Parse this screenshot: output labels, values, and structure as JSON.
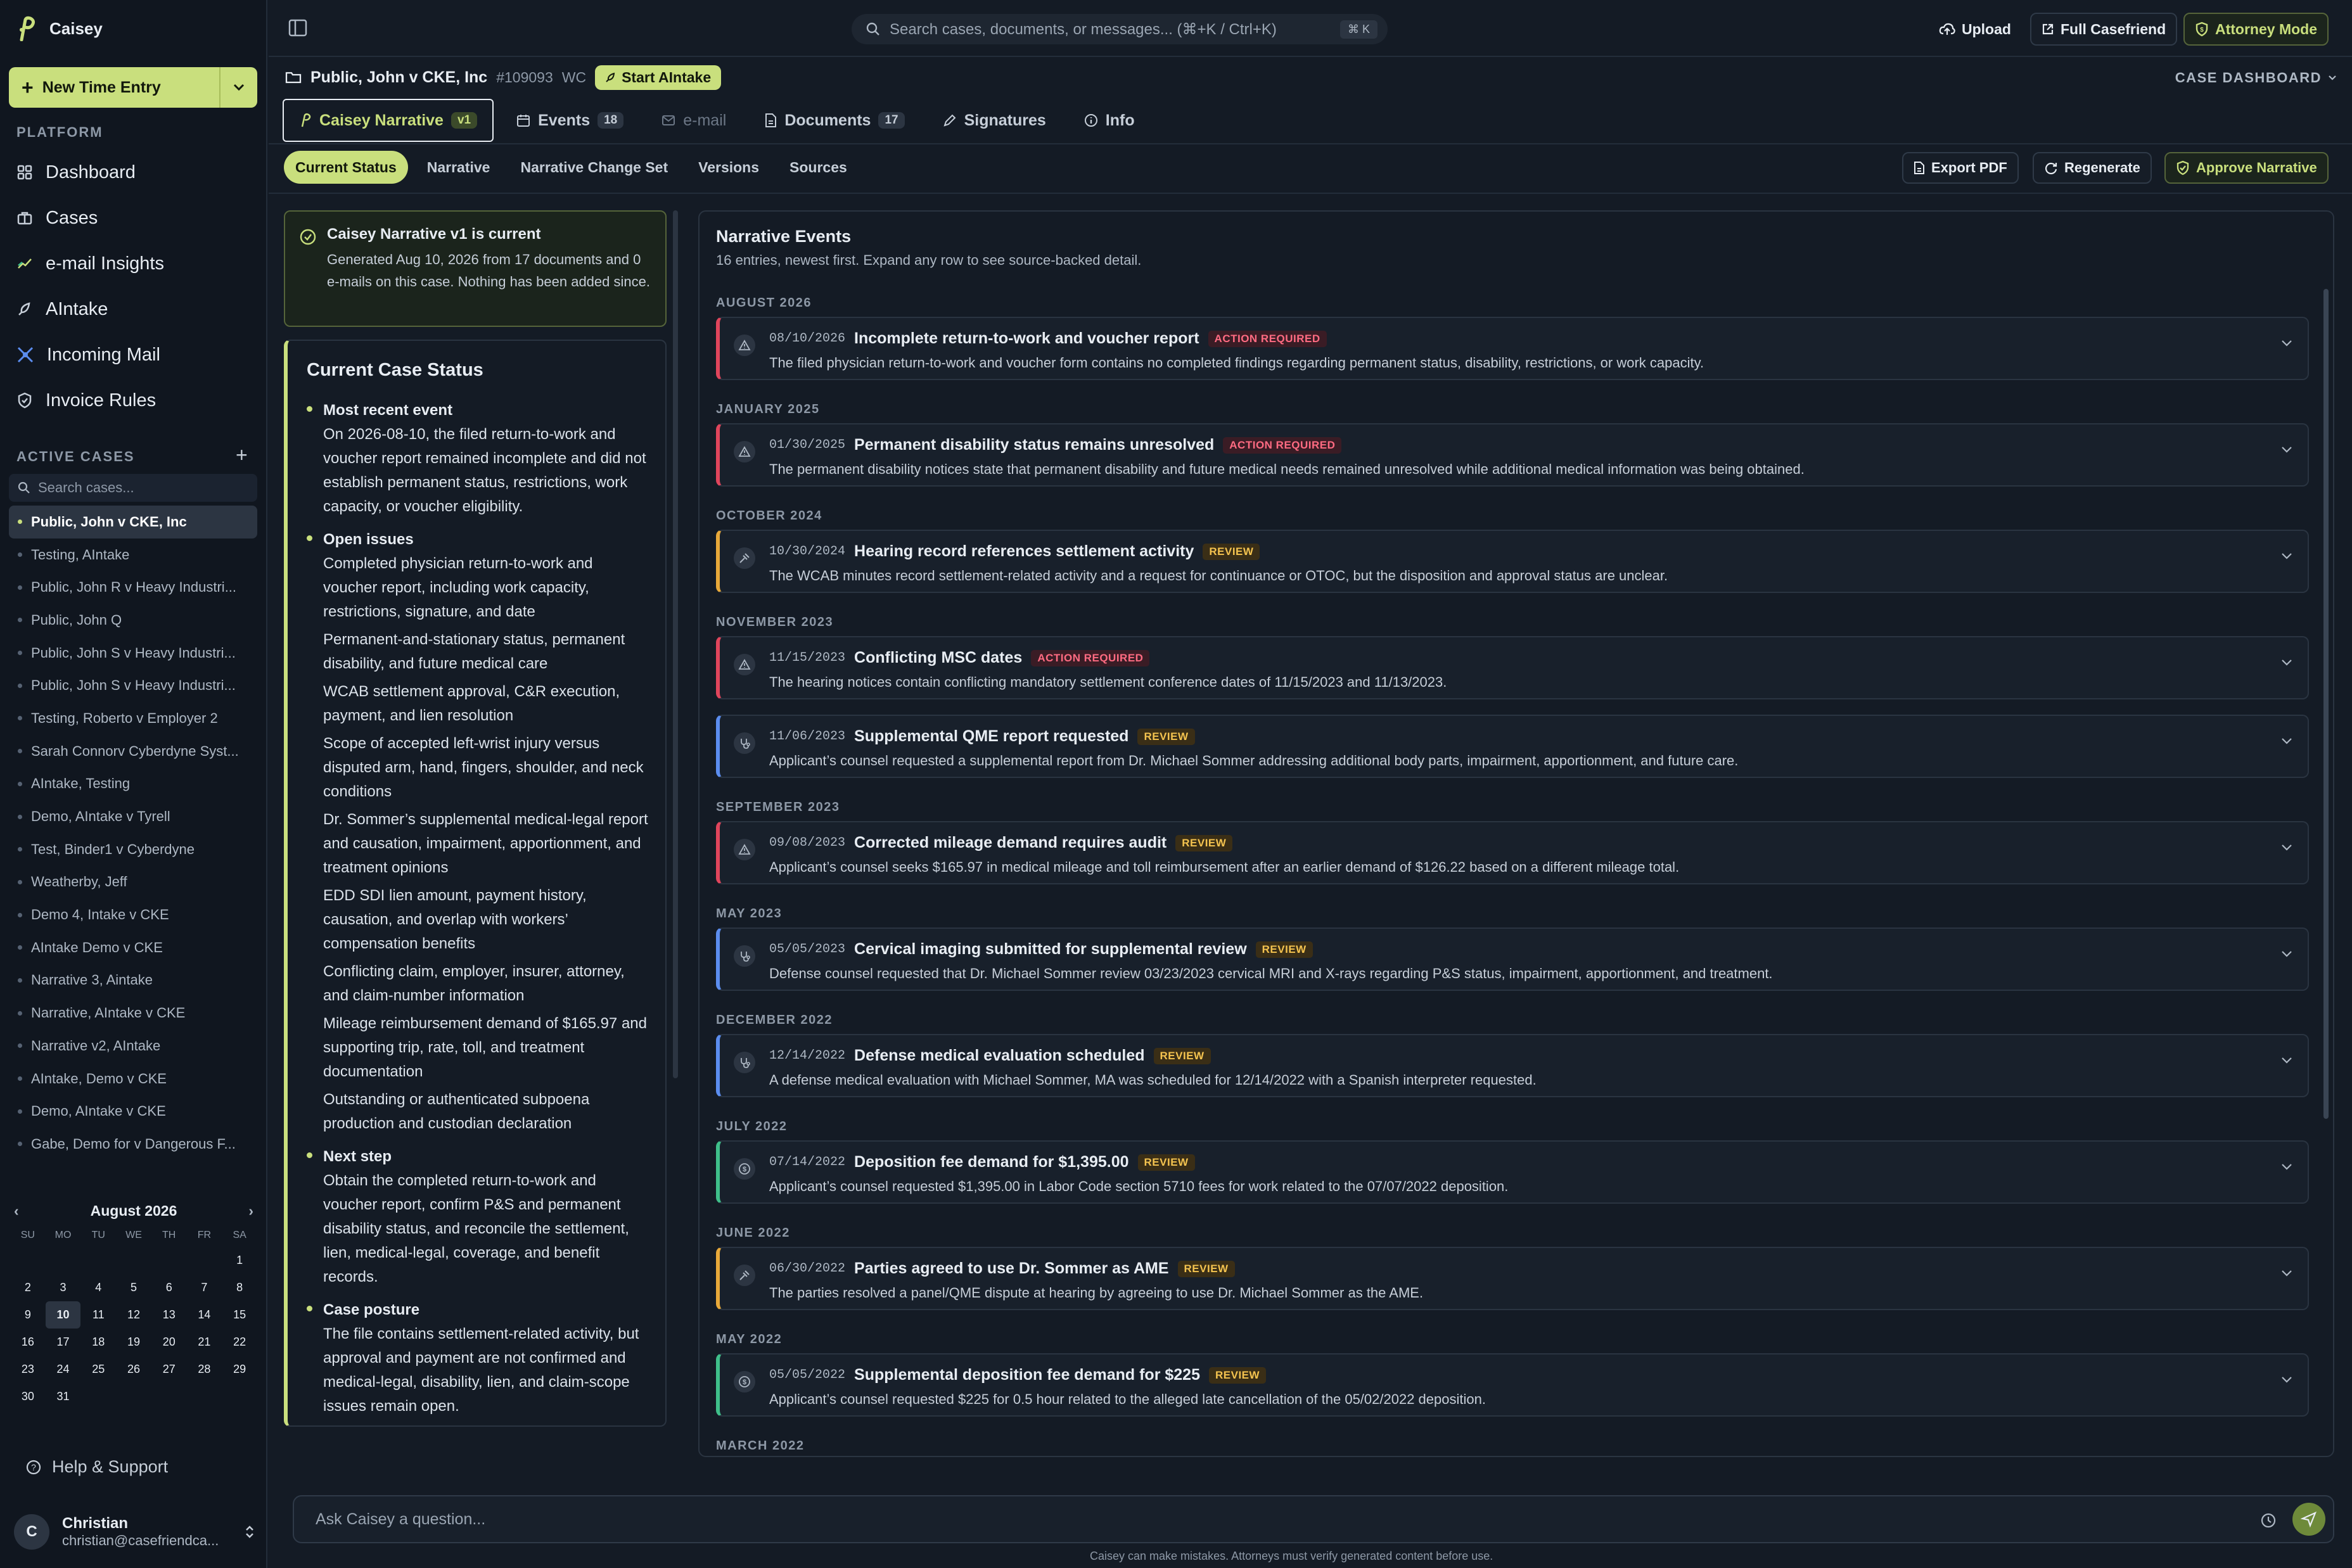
{
  "app": {
    "name": "Caisey"
  },
  "sidebar": {
    "new_time_entry": "New Time Entry",
    "platform_label": "PLATFORM",
    "nav": [
      {
        "label": "Dashboard"
      },
      {
        "label": "Cases"
      },
      {
        "label": "e-mail Insights"
      },
      {
        "label": "AIntake"
      },
      {
        "label": "Incoming Mail"
      },
      {
        "label": "Invoice Rules"
      }
    ],
    "active_cases_label": "ACTIVE CASES",
    "search_placeholder": "Search cases...",
    "cases": [
      "Public, John v CKE, Inc",
      "Testing, AIntake",
      "Public, John R v Heavy Industri...",
      "Public, John Q",
      "Public, John S v Heavy Industri...",
      "Public, John S v Heavy Industri...",
      "Testing, Roberto v Employer 2",
      "Sarah Connorv Cyberdyne Syst...",
      "AIntake, Testing",
      "Demo, AIntake v Tyrell",
      "Test, Binder1 v Cyberdyne",
      "Weatherby, Jeff",
      "Demo 4, Intake v CKE",
      "AIntake Demo v CKE",
      "Narrative 3, Aintake",
      "Narrative, AIntake v CKE",
      "Narrative v2, AIntake",
      "AIntake, Demo v CKE",
      "Demo, AIntake v CKE",
      "Gabe, Demo for v Dangerous F..."
    ],
    "calendar": {
      "month": "August 2026",
      "dow": [
        "SU",
        "MO",
        "TU",
        "WE",
        "TH",
        "FR",
        "SA"
      ],
      "today": "10"
    },
    "help": "Help & Support",
    "user": {
      "initial": "C",
      "name": "Christian",
      "email": "christian@casefriendca..."
    }
  },
  "topbar": {
    "search_placeholder": "Search cases, documents, or messages... (⌘+K / Ctrl+K)",
    "search_kbd": "⌘ K",
    "upload": "Upload",
    "full_casefriend": "Full Casefriend",
    "attorney_mode": "Attorney Mode"
  },
  "case": {
    "title": "Public, John v CKE, Inc",
    "number": "#109093",
    "type": "WC",
    "start_aintake": "Start AIntake",
    "dashboard": "CASE DASHBOARD"
  },
  "tabs": [
    {
      "label": "Caisey Narrative",
      "badge": "v1"
    },
    {
      "label": "Events",
      "badge": "18"
    },
    {
      "label": "e-mail"
    },
    {
      "label": "Documents",
      "badge": "17"
    },
    {
      "label": "Signatures"
    },
    {
      "label": "Info"
    }
  ],
  "subtabs": [
    "Current Status",
    "Narrative",
    "Narrative Change Set",
    "Versions",
    "Sources"
  ],
  "actions": {
    "export": "Export PDF",
    "regenerate": "Regenerate",
    "approve": "Approve Narrative"
  },
  "notice": {
    "title": "Caisey Narrative v1 is current",
    "body": "Generated Aug 10, 2026 from 17 documents and 0 e-mails on this case. Nothing has been added since."
  },
  "status": {
    "heading": "Current Case Status",
    "sections": [
      {
        "title": "Most recent event",
        "items": [
          "On 2026-08-10, the filed return-to-work and voucher report remained incomplete and did not establish permanent status, restrictions, work capacity, or voucher eligibility."
        ]
      },
      {
        "title": "Open issues",
        "items": [
          "Completed physician return-to-work and voucher report, including work capacity, restrictions, signature, and date",
          "Permanent-and-stationary status, permanent disability, and future medical care",
          "WCAB settlement approval, C&R execution, payment, and lien resolution",
          "Scope of accepted left-wrist injury versus disputed arm, hand, fingers, shoulder, and neck conditions",
          "Dr. Sommer’s supplemental medical-legal report and causation, impairment, apportionment, and treatment opinions",
          "EDD SDI lien amount, payment history, causation, and overlap with workers’ compensation benefits",
          "Conflicting claim, employer, insurer, attorney, and claim-number information",
          "Mileage reimbursement demand of $165.97 and supporting trip, rate, toll, and treatment documentation",
          "Outstanding or authenticated subpoena production and custodian declaration"
        ]
      },
      {
        "title": "Next step",
        "items": [
          "Obtain the completed return-to-work and voucher report, confirm P&S and permanent disability status, and reconcile the settlement, lien, medical-legal, coverage, and benefit records."
        ]
      },
      {
        "title": "Case posture",
        "items": [
          "The file contains settlement-related activity, but approval and payment are not confirmed and medical-legal, disability, lien, and claim-scope issues remain open."
        ]
      }
    ]
  },
  "events": {
    "heading": "Narrative Events",
    "subheading": "16 entries, newest first. Expand any row to see source-backed detail.",
    "groups": [
      {
        "month": "AUGUST 2026",
        "items": [
          {
            "date": "08/10/2026",
            "title": "Incomplete return-to-work and voucher report",
            "tag": "ACTION REQUIRED",
            "kind": "action",
            "icon": "warning-icon",
            "desc": "The filed physician return-to-work and voucher form contains no completed findings regarding permanent status, disability, restrictions, or work capacity."
          }
        ]
      },
      {
        "month": "JANUARY 2025",
        "items": [
          {
            "date": "01/30/2025",
            "title": "Permanent disability status remains unresolved",
            "tag": "ACTION REQUIRED",
            "kind": "action",
            "icon": "warning-icon",
            "desc": "The permanent disability notices state that permanent disability and future medical needs remained unresolved while additional medical information was being obtained."
          }
        ]
      },
      {
        "month": "OCTOBER 2024",
        "items": [
          {
            "date": "10/30/2024",
            "title": "Hearing record references settlement activity",
            "tag": "REVIEW",
            "kind": "review",
            "icon": "gavel-icon",
            "desc": "The WCAB minutes record settlement-related activity and a request for continuance or OTOC, but the disposition and approval status are unclear."
          }
        ]
      },
      {
        "month": "NOVEMBER 2023",
        "items": [
          {
            "date": "11/15/2023",
            "title": "Conflicting MSC dates",
            "tag": "ACTION REQUIRED",
            "kind": "action",
            "icon": "warning-icon",
            "desc": "The hearing notices contain conflicting mandatory settlement conference dates of 11/15/2023 and 11/13/2023."
          },
          {
            "date": "11/06/2023",
            "title": "Supplemental QME report requested",
            "tag": "REVIEW",
            "kind": "blue",
            "icon": "stethoscope-icon",
            "desc": "Applicant’s counsel requested a supplemental report from Dr. Michael Sommer addressing additional body parts, impairment, apportionment, and future care."
          }
        ]
      },
      {
        "month": "SEPTEMBER 2023",
        "items": [
          {
            "date": "09/08/2023",
            "title": "Corrected mileage demand requires audit",
            "tag": "REVIEW",
            "kind": "action",
            "icon": "warning-icon",
            "desc": "Applicant’s counsel seeks $165.97 in medical mileage and toll reimbursement after an earlier demand of $126.22 based on a different mileage total."
          }
        ]
      },
      {
        "month": "MAY 2023",
        "items": [
          {
            "date": "05/05/2023",
            "title": "Cervical imaging submitted for supplemental review",
            "tag": "REVIEW",
            "kind": "blue",
            "icon": "stethoscope-icon",
            "desc": "Defense counsel requested that Dr. Michael Sommer review 03/23/2023 cervical MRI and X-rays regarding P&S status, impairment, apportionment, and treatment."
          }
        ]
      },
      {
        "month": "DECEMBER 2022",
        "items": [
          {
            "date": "12/14/2022",
            "title": "Defense medical evaluation scheduled",
            "tag": "REVIEW",
            "kind": "blue",
            "icon": "stethoscope-icon",
            "desc": "A defense medical evaluation with Michael Sommer, MA was scheduled for 12/14/2022 with a Spanish interpreter requested."
          }
        ]
      },
      {
        "month": "JULY 2022",
        "items": [
          {
            "date": "07/14/2022",
            "title": "Deposition fee demand for $1,395.00",
            "tag": "REVIEW",
            "kind": "green",
            "icon": "dollar-icon",
            "desc": "Applicant’s counsel requested $1,395.00 in Labor Code section 5710 fees for work related to the 07/07/2022 deposition."
          }
        ]
      },
      {
        "month": "JUNE 2022",
        "items": [
          {
            "date": "06/30/2022",
            "title": "Parties agreed to use Dr. Sommer as AME",
            "tag": "REVIEW",
            "kind": "review",
            "icon": "gavel-icon",
            "desc": "The parties resolved a panel/QME dispute at hearing by agreeing to use Dr. Michael Sommer as the AME."
          }
        ]
      },
      {
        "month": "MAY 2022",
        "items": [
          {
            "date": "05/05/2022",
            "title": "Supplemental deposition fee demand for $225",
            "tag": "REVIEW",
            "kind": "green",
            "icon": "dollar-icon",
            "desc": "Applicant’s counsel requested $225 for 0.5 hour related to the alleged late cancellation of the 05/02/2022 deposition."
          }
        ]
      },
      {
        "month": "MARCH 2022",
        "items": []
      }
    ]
  },
  "ask": {
    "placeholder": "Ask Caisey a question...",
    "disclaimer": "Caisey can make mistakes. Attorneys must verify generated content before use."
  }
}
